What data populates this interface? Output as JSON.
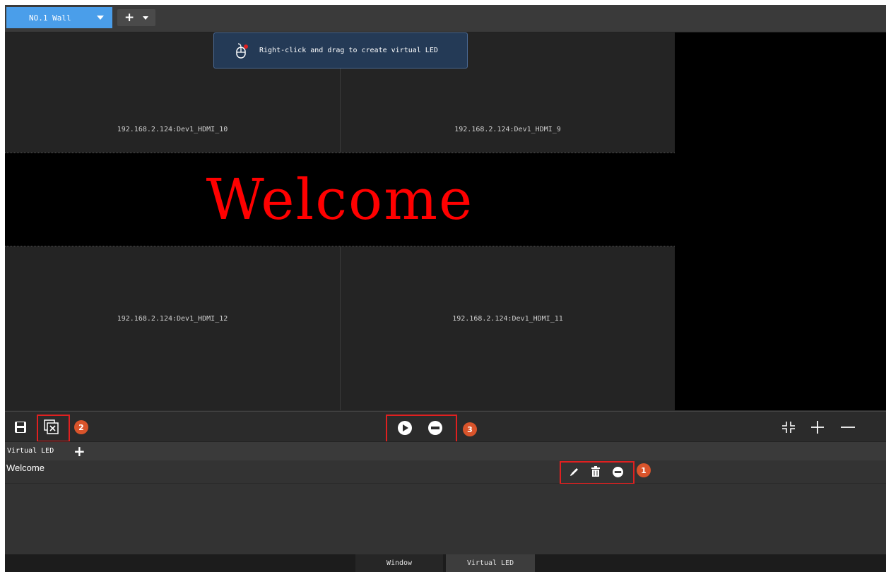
{
  "topbar": {
    "wall_tab_label": "NO.1 Wall",
    "add_tab_plus": "+"
  },
  "tooltip": {
    "text": "Right-click and drag to create virtual LED"
  },
  "screens": [
    {
      "label": "192.168.2.124:Dev1_HDMI_10"
    },
    {
      "label": "192.168.2.124:Dev1_HDMI_9"
    },
    {
      "label": "192.168.2.124:Dev1_HDMI_12"
    },
    {
      "label": "192.168.2.124:Dev1_HDMI_11"
    }
  ],
  "virtual_led_overlay": {
    "text": "Welcome",
    "text_color": "#ff0000"
  },
  "toolbar": {
    "badge_2": "2",
    "badge_3": "3",
    "icons": [
      "save-icon",
      "clear-windows-icon",
      "play-icon",
      "stop-icon",
      "fit-screen-icon",
      "zoom-in-icon",
      "zoom-out-icon"
    ]
  },
  "virtual_led_panel": {
    "title": "Virtual LED",
    "add_label": "+",
    "items": [
      {
        "name": "Welcome",
        "badge": "1"
      }
    ]
  },
  "bottom_tabs": [
    {
      "label": "Window",
      "active": false
    },
    {
      "label": "Virtual LED",
      "active": true
    }
  ],
  "colors": {
    "accent": "#4a9eea",
    "badge": "#d9542b",
    "highlight_box": "#e02020"
  }
}
